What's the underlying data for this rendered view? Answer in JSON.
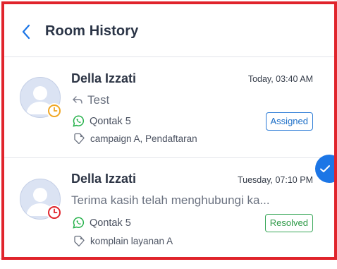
{
  "header": {
    "title": "Room History",
    "back_icon": "chevron-left-icon"
  },
  "rooms": [
    {
      "name": "Della Izzati",
      "time": "Today, 03:40 AM",
      "message": "Test",
      "message_icon": "reply-icon",
      "channel": "Qontak 5",
      "channel_icon": "whatsapp-icon",
      "tags": "campaign A, Pendaftaran",
      "status": "Assigned",
      "status_color": "#2b7bd6",
      "indicator_icon": "clock-icon",
      "indicator_color": "#f0a623"
    },
    {
      "name": "Della Izzati",
      "time": "Tuesday, 07:10 PM",
      "message": "Terima kasih telah menghubungi ka...",
      "channel": "Qontak 5",
      "channel_icon": "whatsapp-icon",
      "tags": "komplain layanan A",
      "status": "Resolved",
      "status_color": "#3aa85a",
      "indicator_icon": "clock-icon",
      "indicator_color": "#e0242c",
      "selected": true
    }
  ],
  "colors": {
    "accent": "#1c76e6",
    "frame": "#e0242c",
    "whatsapp": "#25b14a"
  }
}
